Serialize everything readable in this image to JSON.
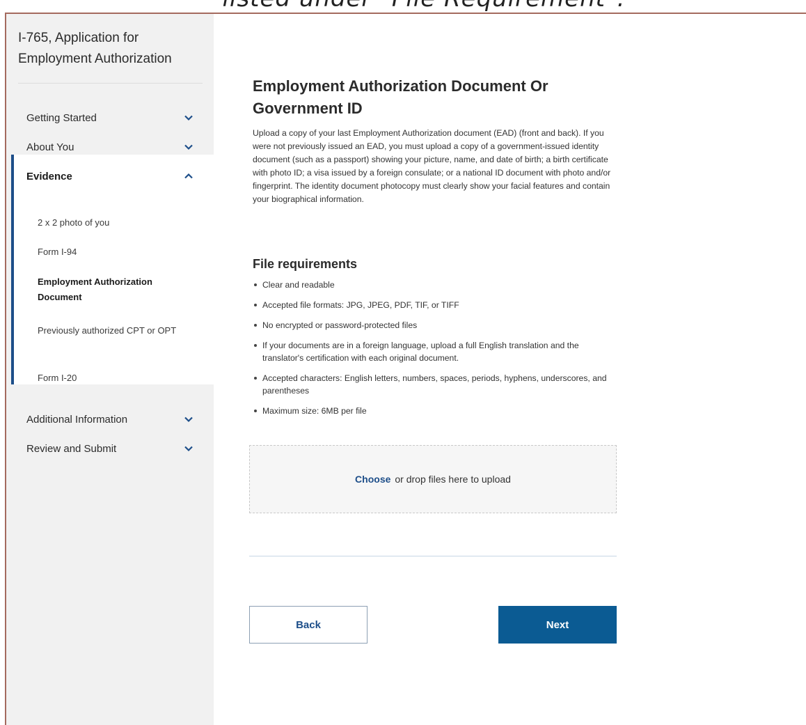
{
  "top_caption": "listed under \"File Requirement\".",
  "sidebar": {
    "title": "I-765, Application for Employment Authorization",
    "nav": [
      {
        "label": "Getting Started",
        "icon": "chevron-down-icon"
      },
      {
        "label": "About You",
        "icon": "chevron-down-icon"
      }
    ],
    "evidence": {
      "label": "Evidence",
      "icon": "chevron-up-icon",
      "items": [
        {
          "label": "2 x 2 photo of you"
        },
        {
          "label": "Form I-94"
        },
        {
          "label": "Employment Authorization Document",
          "active": true
        },
        {
          "label": "Previously authorized CPT or OPT"
        },
        {
          "label": "Form I-20"
        }
      ]
    },
    "nav_after": [
      {
        "label": "Additional Information",
        "icon": "chevron-down-icon"
      },
      {
        "label": "Review and Submit",
        "icon": "chevron-down-icon"
      }
    ]
  },
  "main": {
    "title": "Employment Authorization Document Or Government ID",
    "intro": "Upload a copy of your last Employment Authorization document (EAD) (front and back). If you were not previously issued an EAD, you must upload a copy of a government-issued identity document (such as a passport) showing your picture, name, and date of birth; a birth certificate with photo ID; a visa issued by a foreign consulate; or a national ID document with photo and/or fingerprint. The identity document photocopy must clearly show your facial features and contain your biographical information.",
    "requirements_heading": "File requirements",
    "requirements": [
      "Clear and readable",
      "Accepted file formats: JPG, JPEG, PDF, TIF, or TIFF",
      "No encrypted or password-protected files",
      "If your documents are in a foreign language, upload a full English translation and the translator's certification with each original document.",
      "Accepted characters: English letters, numbers, spaces, periods, hyphens, underscores, and parentheses",
      "Maximum size: 6MB per file"
    ],
    "upload": {
      "choose_label": "Choose",
      "drop_text": "or drop files here to upload"
    },
    "back_label": "Back",
    "next_label": "Next"
  },
  "colors": {
    "primary": "#0b5b93",
    "accent_bar": "#1d4e89",
    "sidebar_bg": "#f1f1f1"
  }
}
